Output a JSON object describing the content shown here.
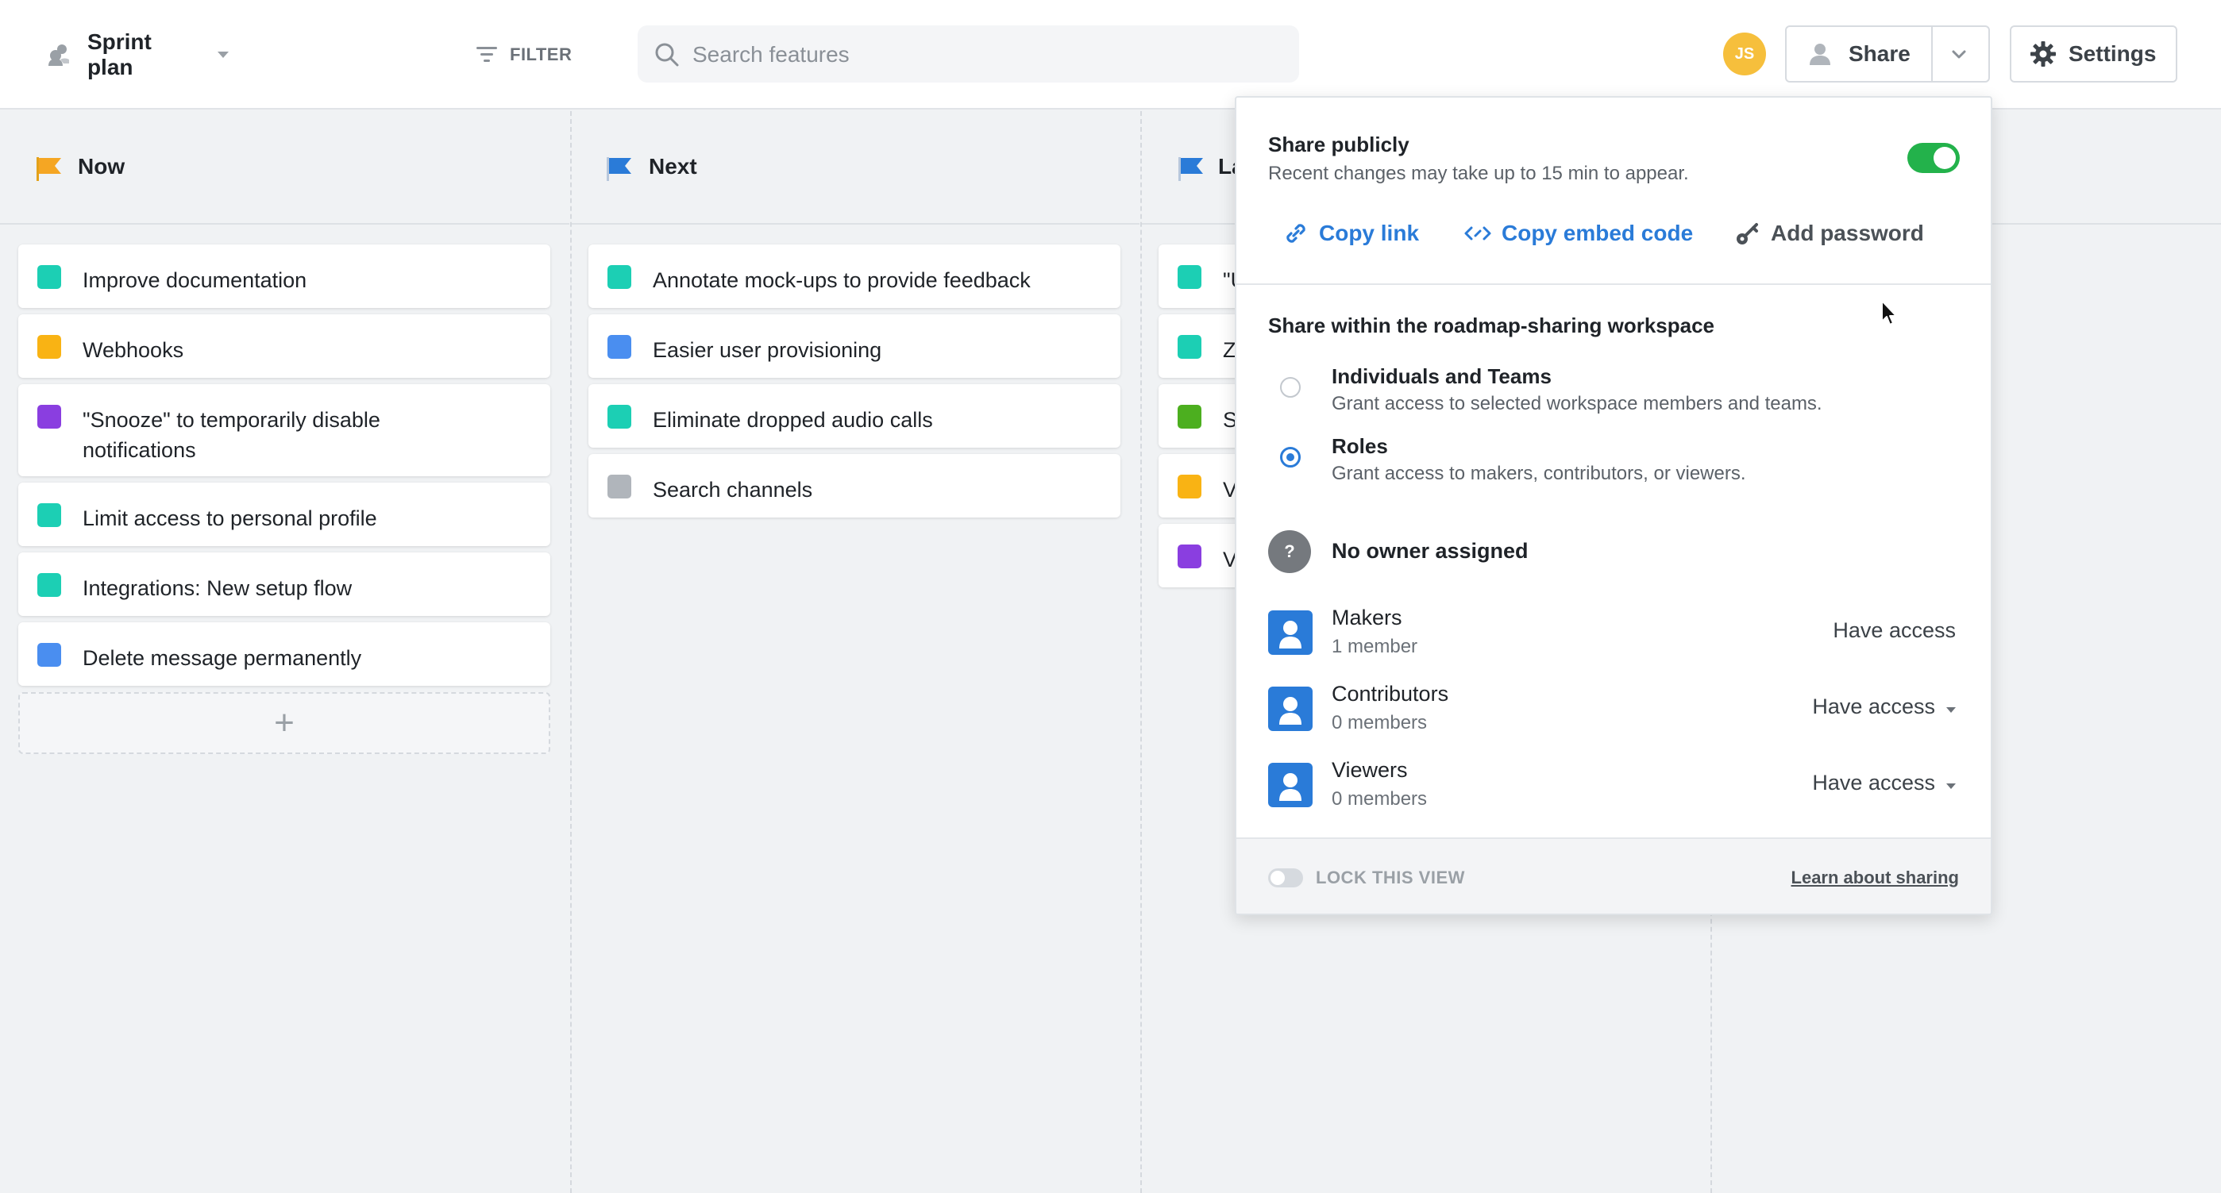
{
  "header": {
    "plan_name": "Sprint plan",
    "filter_label": "FILTER",
    "search_placeholder": "Search features",
    "avatar_initials": "JS",
    "share_label": "Share",
    "settings_label": "Settings"
  },
  "columns": [
    {
      "title": "Now",
      "flag_color": "#f5a623",
      "cards": [
        {
          "label": "Improve documentation",
          "color": "#1ccfb4"
        },
        {
          "label": "Webhooks",
          "color": "#f9b314"
        },
        {
          "label": "\"Snooze\" to temporarily disable notifications",
          "color": "#8a3ee0"
        },
        {
          "label": "Limit access to personal profile",
          "color": "#1ccfb4"
        },
        {
          "label": "Integrations: New setup flow",
          "color": "#1ccfb4"
        },
        {
          "label": "Delete message permanently",
          "color": "#4a8ef0"
        }
      ]
    },
    {
      "title": "Next",
      "flag_color": "#2a7bd8",
      "cards": [
        {
          "label": "Annotate mock-ups to provide feedback",
          "color": "#1ccfb4"
        },
        {
          "label": "Easier user provisioning",
          "color": "#4a8ef0"
        },
        {
          "label": "Eliminate dropped audio calls",
          "color": "#1ccfb4"
        },
        {
          "label": "Search channels",
          "color": "#b0b5bb"
        }
      ]
    },
    {
      "title": "La",
      "flag_color": "#2a7bd8",
      "cards": [
        {
          "label": "\"U",
          "color": "#1ccfb4"
        },
        {
          "label": "Zl",
          "color": "#1ccfb4"
        },
        {
          "label": "Su",
          "color": "#4caf1f"
        },
        {
          "label": "Vi",
          "color": "#f9b314"
        },
        {
          "label": "Vi",
          "color": "#8a3ee0"
        }
      ]
    }
  ],
  "share_panel": {
    "public_title": "Share publicly",
    "public_sub": "Recent changes may take up to 15 min to appear.",
    "public_enabled": true,
    "copy_link": "Copy link",
    "copy_embed": "Copy embed code",
    "add_password": "Add password",
    "workspace_title": "Share within the roadmap-sharing workspace",
    "options": [
      {
        "title": "Individuals and Teams",
        "sub": "Grant access to selected workspace members and teams.",
        "selected": false
      },
      {
        "title": "Roles",
        "sub": "Grant access to makers, contributors, or viewers.",
        "selected": true
      }
    ],
    "owner_label": "No owner assigned",
    "roles": [
      {
        "name": "Makers",
        "count": "1 member",
        "access": "Have access"
      },
      {
        "name": "Contributors",
        "count": "0 members",
        "access": "Have access"
      },
      {
        "name": "Viewers",
        "count": "0 members",
        "access": "Have access"
      }
    ],
    "lock_label": "LOCK THIS VIEW",
    "learn_label": "Learn about sharing"
  }
}
